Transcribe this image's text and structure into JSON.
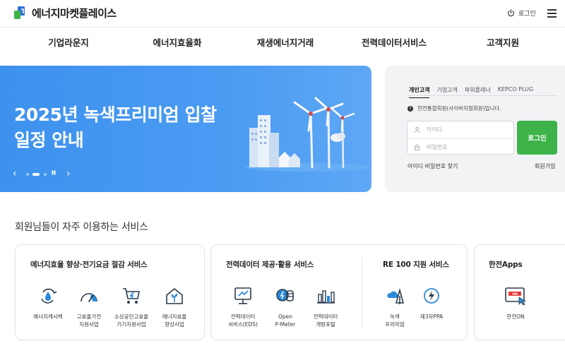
{
  "header": {
    "logo_text": "에너지마켓플레이스",
    "login_label": "로그인"
  },
  "nav": {
    "items": [
      "기업라운지",
      "에너지효율화",
      "재생에너지거래",
      "전력데이터서비스",
      "고객지원"
    ]
  },
  "banner": {
    "title_line1": "2025년 녹색프리미엄 입찰",
    "title_line2": "일정 안내",
    "prev": "‹",
    "pause": "❚❚",
    "next": "›",
    "slide_index": 2,
    "slide_count": 4
  },
  "login": {
    "tabs": [
      "개인고객",
      "기업고객",
      "파워플래너",
      "KEPCO PLUG"
    ],
    "active_tab": 0,
    "notice": "한전통합회원(사이버지점회원)입니다.",
    "id_placeholder": "아이디",
    "pw_placeholder": "비밀번호",
    "button": "로그인",
    "find": "아이디 비밀번호 찾기",
    "join": "회원가입"
  },
  "services": {
    "section_title": "회원님들이 자주 이용하는 서비스",
    "cards": [
      {
        "title": "에너지효율 향상·전기요금 절감 서비스",
        "items": [
          {
            "icon": "water-cycle-icon",
            "label": "에너지캐시백"
          },
          {
            "icon": "speedometer-icon",
            "label": "고효율가전\n지원사업"
          },
          {
            "icon": "shopping-cart-icon",
            "label": "소상공인고효율\n기기지원사업"
          },
          {
            "icon": "eco-house-icon",
            "label": "에너지효율\n향상사업"
          }
        ]
      },
      {
        "title": "전력데이터 제공·활용 서비스",
        "items": [
          {
            "icon": "monitor-icon",
            "label": "전력데이터\n서비스(EDS)"
          },
          {
            "icon": "meter-icon",
            "label": "Open\nP-Meter"
          },
          {
            "icon": "bar-chart-icon",
            "label": "전력데이터\n개방포털"
          }
        ],
        "sub_title": "RE 100 지원 서비스",
        "sub_items": [
          {
            "icon": "cloud-tree-icon",
            "label": "녹색\n프리미엄"
          },
          {
            "icon": "lightning-icon",
            "label": "제3자PPA"
          }
        ]
      },
      {
        "title": "한전Apps",
        "items": [
          {
            "icon": "app-on-icon",
            "label": "한전ON"
          }
        ]
      }
    ]
  },
  "colors": {
    "banner_blue": "#3d92ee",
    "login_green": "#3db34a",
    "icon_blue": "#2d8ad8",
    "icon_dark": "#2b3a4a"
  }
}
